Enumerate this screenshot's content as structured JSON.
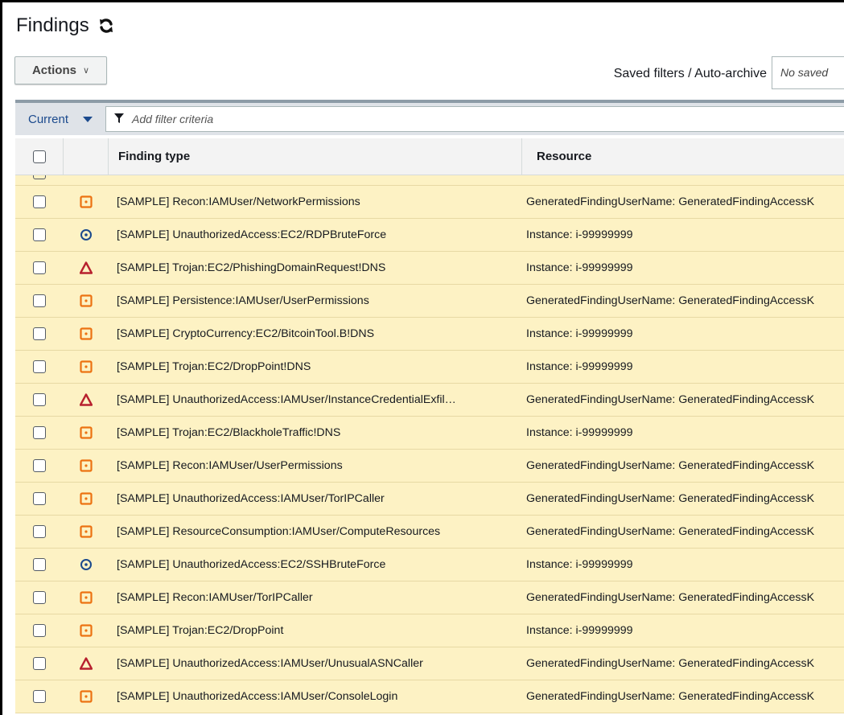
{
  "header": {
    "title": "Findings",
    "refresh_icon": "refresh-icon"
  },
  "toolbar": {
    "actions_label": "Actions",
    "actions_caret": "∨",
    "saved_filters_label": "Saved filters / Auto-archive",
    "saved_filters_value": "No saved"
  },
  "filter": {
    "scope_label": "Current",
    "placeholder": "Add filter criteria"
  },
  "table": {
    "columns": {
      "finding_type": "Finding type",
      "resource": "Resource"
    },
    "rows": [
      {
        "severity": "medium",
        "type": "[SAMPLE] Recon:IAMUser/NetworkPermissions",
        "resource": "GeneratedFindingUserName: GeneratedFindingAccessK"
      },
      {
        "severity": "low",
        "type": "[SAMPLE] UnauthorizedAccess:EC2/RDPBruteForce",
        "resource": "Instance: i-99999999"
      },
      {
        "severity": "high",
        "type": "[SAMPLE] Trojan:EC2/PhishingDomainRequest!DNS",
        "resource": "Instance: i-99999999"
      },
      {
        "severity": "medium",
        "type": "[SAMPLE] Persistence:IAMUser/UserPermissions",
        "resource": "GeneratedFindingUserName: GeneratedFindingAccessK"
      },
      {
        "severity": "medium",
        "type": "[SAMPLE] CryptoCurrency:EC2/BitcoinTool.B!DNS",
        "resource": "Instance: i-99999999"
      },
      {
        "severity": "medium",
        "type": "[SAMPLE] Trojan:EC2/DropPoint!DNS",
        "resource": "Instance: i-99999999"
      },
      {
        "severity": "high",
        "type": "[SAMPLE] UnauthorizedAccess:IAMUser/InstanceCredentialExfil…",
        "resource": "GeneratedFindingUserName: GeneratedFindingAccessK"
      },
      {
        "severity": "medium",
        "type": "[SAMPLE] Trojan:EC2/BlackholeTraffic!DNS",
        "resource": "Instance: i-99999999"
      },
      {
        "severity": "medium",
        "type": "[SAMPLE] Recon:IAMUser/UserPermissions",
        "resource": "GeneratedFindingUserName: GeneratedFindingAccessK"
      },
      {
        "severity": "medium",
        "type": "[SAMPLE] UnauthorizedAccess:IAMUser/TorIPCaller",
        "resource": "GeneratedFindingUserName: GeneratedFindingAccessK"
      },
      {
        "severity": "medium",
        "type": "[SAMPLE] ResourceConsumption:IAMUser/ComputeResources",
        "resource": "GeneratedFindingUserName: GeneratedFindingAccessK"
      },
      {
        "severity": "low",
        "type": "[SAMPLE] UnauthorizedAccess:EC2/SSHBruteForce",
        "resource": "Instance: i-99999999"
      },
      {
        "severity": "medium",
        "type": "[SAMPLE] Recon:IAMUser/TorIPCaller",
        "resource": "GeneratedFindingUserName: GeneratedFindingAccessK"
      },
      {
        "severity": "medium",
        "type": "[SAMPLE] Trojan:EC2/DropPoint",
        "resource": "Instance: i-99999999"
      },
      {
        "severity": "high",
        "type": "[SAMPLE] UnauthorizedAccess:IAMUser/UnusualASNCaller",
        "resource": "GeneratedFindingUserName: GeneratedFindingAccessK"
      },
      {
        "severity": "medium",
        "type": "[SAMPLE] UnauthorizedAccess:IAMUser/ConsoleLogin",
        "resource": "GeneratedFindingUserName: GeneratedFindingAccessK"
      }
    ]
  },
  "colors": {
    "row_background": "#fdf2c4",
    "severity_high": "#b7202e",
    "severity_medium": "#ec7211",
    "severity_low": "#1b4a8d",
    "link_blue": "#1b4a8d"
  },
  "icons": {
    "high": "triangle-warning-icon",
    "medium": "square-dot-icon",
    "low": "circle-dot-icon",
    "filter": "funnel-icon"
  }
}
